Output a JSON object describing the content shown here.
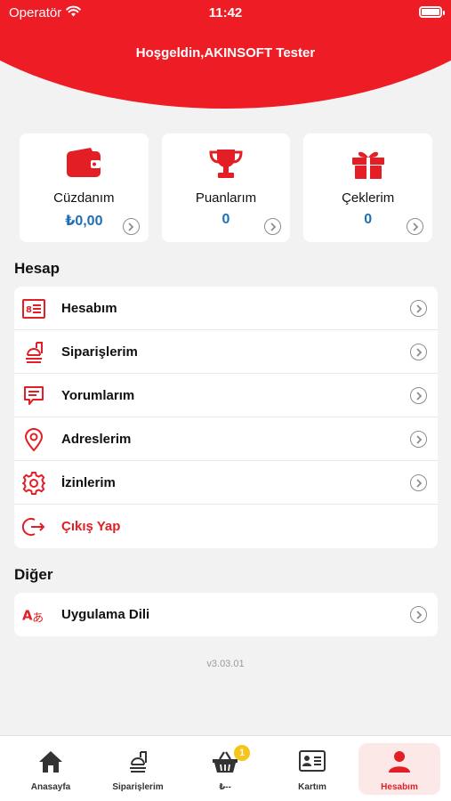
{
  "status_bar": {
    "carrier": "Operatör",
    "time": "11:42",
    "battery_level": 1.0
  },
  "header": {
    "welcome": "Hoşgeldin,AKINSOFT Tester"
  },
  "cards": [
    {
      "title": "Cüzdanım",
      "value": "₺0,00",
      "icon": "wallet-icon"
    },
    {
      "title": "Puanlarım",
      "value": "0",
      "icon": "trophy-icon"
    },
    {
      "title": "Çeklerim",
      "value": "0",
      "icon": "gift-icon"
    }
  ],
  "account": {
    "title": "Hesap",
    "items": [
      {
        "label": "Hesabım",
        "icon": "id-card-icon"
      },
      {
        "label": "Siparişlerim",
        "icon": "orders-icon"
      },
      {
        "label": "Yorumlarım",
        "icon": "comment-icon"
      },
      {
        "label": "Adreslerim",
        "icon": "location-pin-icon"
      },
      {
        "label": "İzinlerim",
        "icon": "gear-icon"
      },
      {
        "label": "Çıkış Yap",
        "icon": "logout-icon"
      }
    ]
  },
  "other": {
    "title": "Diğer",
    "items": [
      {
        "label": "Uygulama Dili",
        "icon": "language-icon"
      }
    ]
  },
  "version": "v3.03.01",
  "tabbar": {
    "tabs": [
      {
        "label": "Anasayfa",
        "icon": "home-icon"
      },
      {
        "label": "Siparişlerim",
        "icon": "orders-icon"
      },
      {
        "label": "₺--",
        "icon": "basket-icon",
        "badge": "1"
      },
      {
        "label": "Kartım",
        "icon": "card-icon"
      },
      {
        "label": "Hesabım",
        "icon": "person-icon",
        "active": true
      }
    ]
  },
  "colors": {
    "brand": "#ee1c25",
    "value_blue": "#1f6fb5",
    "badge": "#f5c518",
    "background": "#f2f2f2"
  }
}
